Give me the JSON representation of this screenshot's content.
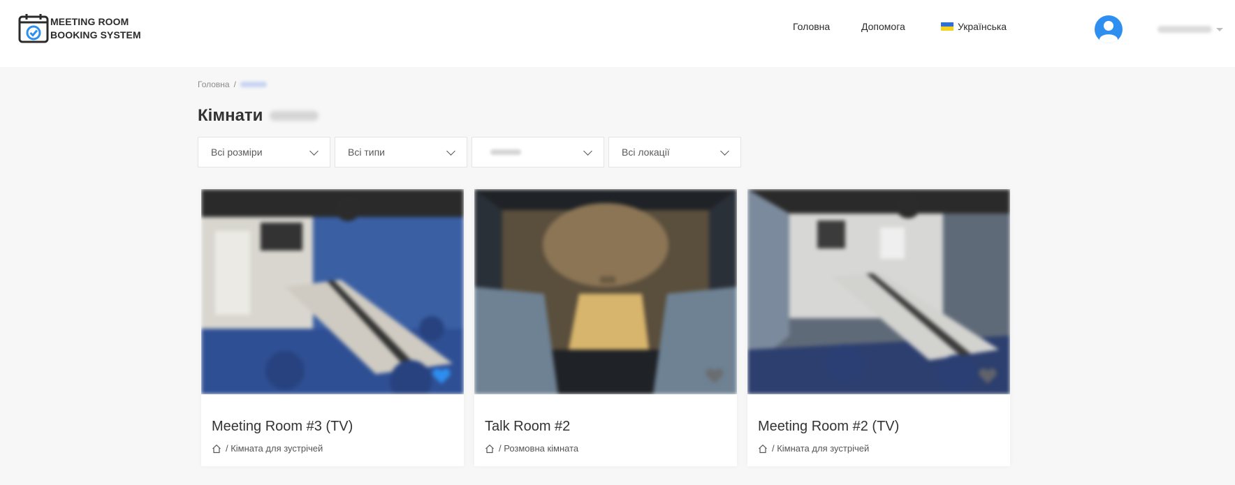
{
  "logo": {
    "line1": "MEETING ROOM",
    "line2": "BOOKING SYSTEM"
  },
  "nav": {
    "home": "Головна",
    "help": "Допомога",
    "language": "Українська"
  },
  "breadcrumb": {
    "home": "Головна",
    "separator": "/"
  },
  "page": {
    "title": "Кімнати"
  },
  "filters": {
    "sizes": "Всі розміри",
    "types": "Всі типи",
    "locations": "Всі локації"
  },
  "cards": [
    {
      "title": "Meeting Room #3 (TV)",
      "type": "/ Кімната для зустрічей",
      "favorite": true
    },
    {
      "title": "Talk Room #2",
      "type": "/ Розмовна кімната",
      "favorite": false
    },
    {
      "title": "Meeting Room #2 (TV)",
      "type": "/ Кімната для зустрічей",
      "favorite": false
    }
  ],
  "colors": {
    "accent": "#2e8ff0",
    "favorite_active": "#2e8ff0",
    "favorite_inactive": "#7a7a7a"
  }
}
